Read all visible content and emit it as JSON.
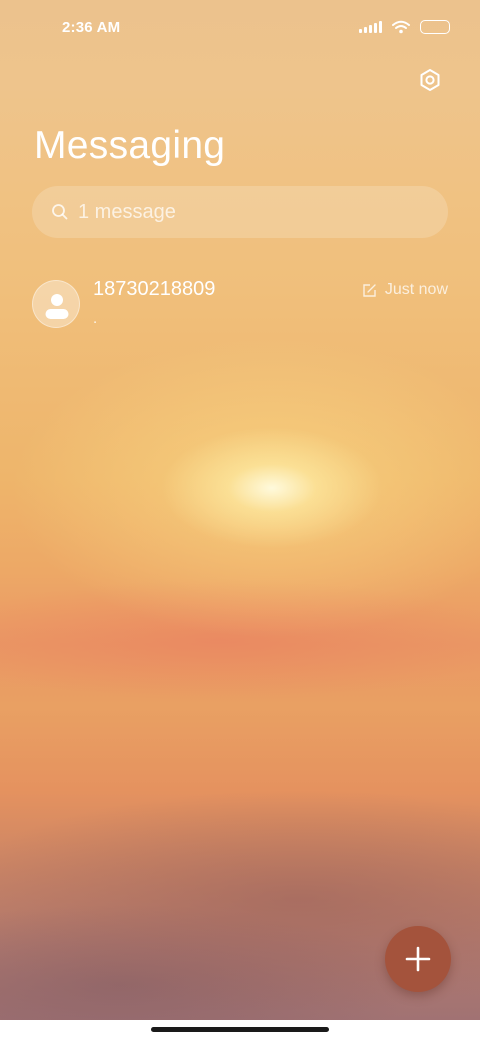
{
  "status_bar": {
    "time": "2:36 AM",
    "icons": [
      "signal-icon",
      "wifi-icon",
      "battery-icon"
    ]
  },
  "header": {
    "title": "Messaging",
    "settings_icon": "gear-icon"
  },
  "search": {
    "placeholder": "1 message",
    "icon": "search-icon"
  },
  "conversations": [
    {
      "name": "18730218809",
      "preview": ".",
      "time": "Just now",
      "draft_icon": "draft-edit-icon",
      "avatar_icon": "person-icon"
    }
  ],
  "fab": {
    "icon": "plus-icon",
    "color": "#a4533c"
  }
}
